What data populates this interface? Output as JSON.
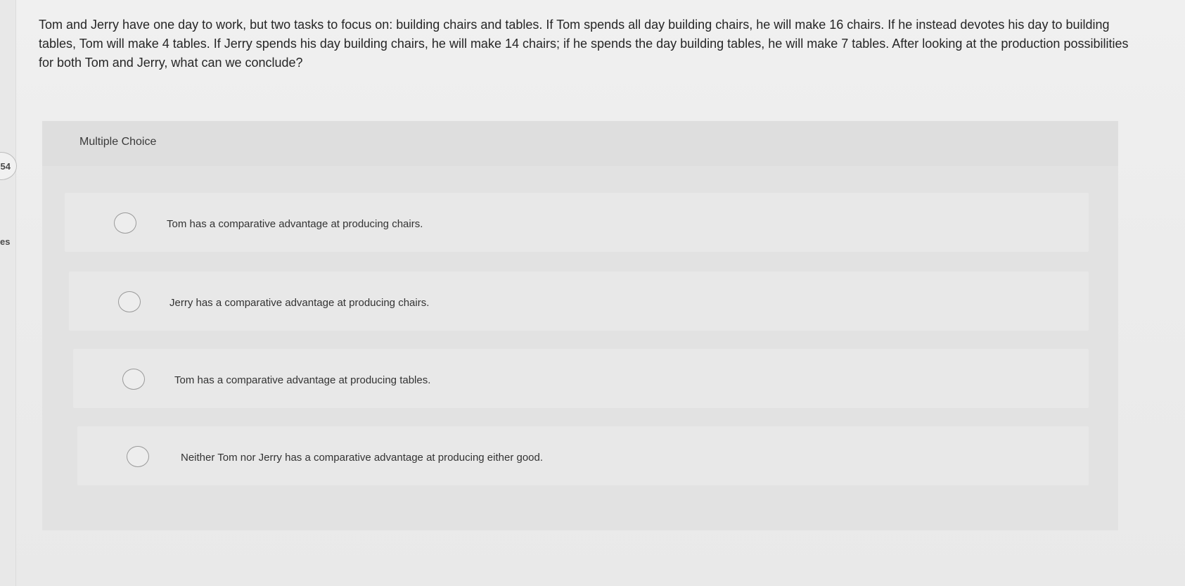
{
  "sidebar": {
    "badge_value": "54",
    "partial_label": "es"
  },
  "question": {
    "text": "Tom and Jerry have one day to work, but two tasks to focus on: building chairs and tables. If Tom spends all day building chairs, he will make 16 chairs. If he instead devotes his day to building tables, Tom will make 4 tables. If Jerry spends his day building chairs, he will make 14 chairs; if he spends the day building tables, he will make 7 tables. After looking at the production possibilities for both Tom and Jerry, what can we conclude?"
  },
  "multiple_choice": {
    "label": "Multiple Choice",
    "options": [
      {
        "label": "Tom has a comparative advantage at producing chairs."
      },
      {
        "label": "Jerry has a comparative advantage at producing chairs."
      },
      {
        "label": "Tom has a comparative advantage at producing tables."
      },
      {
        "label": "Neither Tom nor Jerry has a comparative advantage at producing either good."
      }
    ]
  }
}
